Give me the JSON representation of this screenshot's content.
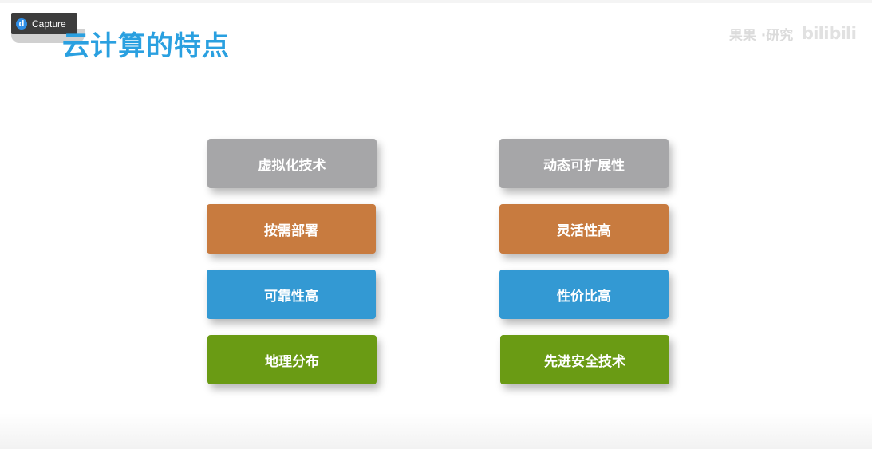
{
  "capture_badge": {
    "label": "Capture",
    "logo_letter": "d"
  },
  "slide": {
    "title": "云计算的特点",
    "watermark": {
      "text": "果果 ·研究",
      "logo": "bilibili"
    }
  },
  "features": {
    "left": [
      "虚拟化技术",
      "按需部署",
      "可靠性高",
      "地理分布"
    ],
    "right": [
      "动态可扩展性",
      "灵活性高",
      "性价比高",
      "先进安全技术"
    ]
  },
  "colors": {
    "title": "#2aa0e0",
    "row_1": "#a6a6a8",
    "row_2": "#c87b3f",
    "row_3": "#3399d3",
    "row_4": "#6a9b14"
  }
}
